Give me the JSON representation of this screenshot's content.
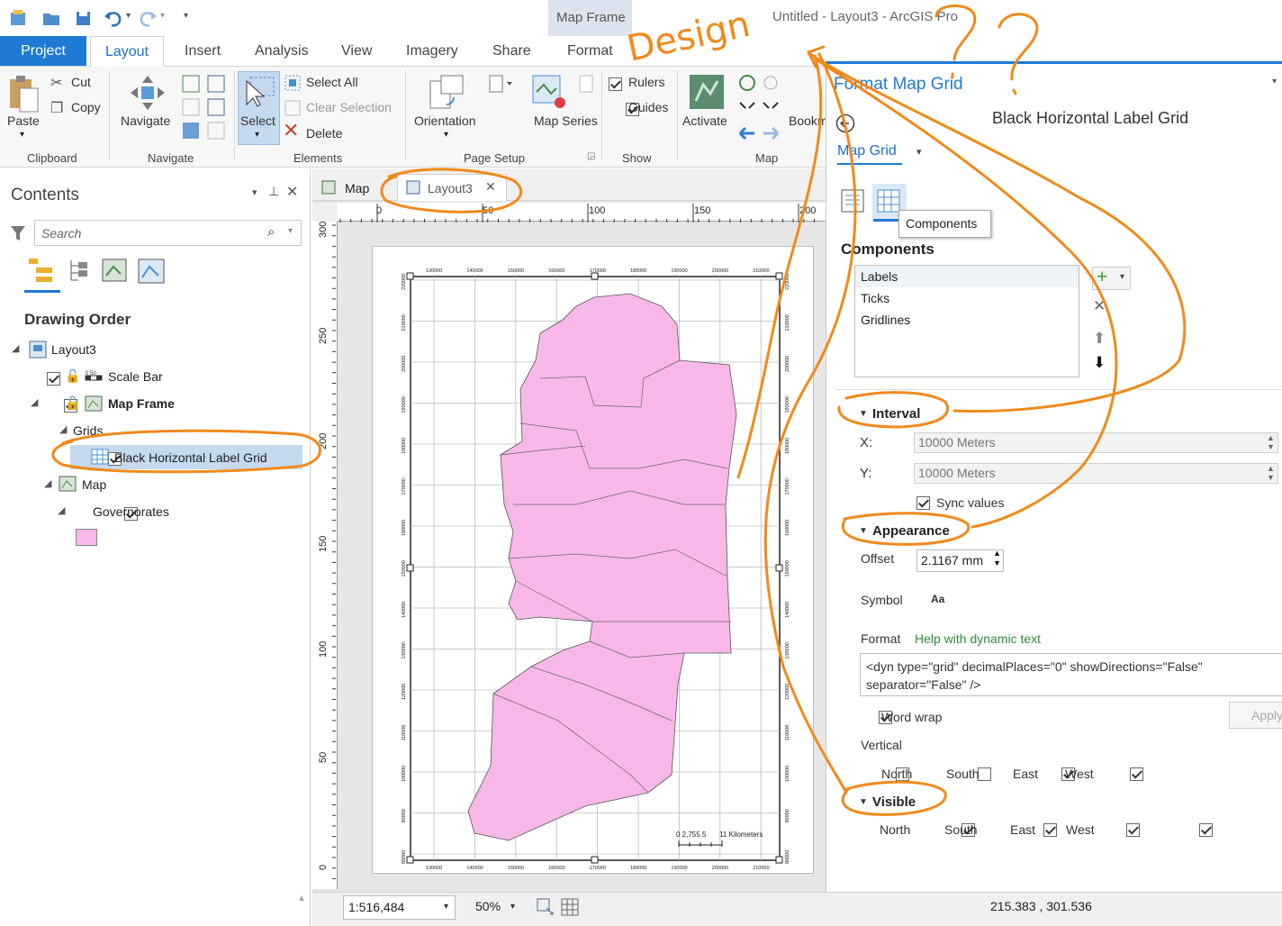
{
  "window_title": "Untitled - Layout3 - ArcGIS Pro",
  "context_tab_group": "Map Frame",
  "tabs": [
    "Project",
    "Layout",
    "Insert",
    "Analysis",
    "View",
    "Imagery",
    "Share",
    "Format"
  ],
  "ribbon": {
    "clipboard": {
      "paste": "Paste",
      "cut": "Cut",
      "copy": "Copy",
      "label": "Clipboard"
    },
    "navigate": {
      "navigate": "Navigate",
      "label": "Navigate"
    },
    "elements": {
      "select": "Select",
      "select_all": "Select All",
      "clear_selection": "Clear Selection",
      "delete": "Delete",
      "label": "Elements"
    },
    "page_setup": {
      "orientation": "Orientation",
      "map_series": "Map Series",
      "label": "Page Setup"
    },
    "show": {
      "rulers": "Rulers",
      "guides": "Guides",
      "label": "Show"
    },
    "map": {
      "activate": "Activate",
      "bookmarks": "Bookm",
      "label": "Map"
    }
  },
  "contents": {
    "title": "Contents",
    "search_placeholder": "Search",
    "drawing_order": "Drawing Order",
    "tree": {
      "layout": "Layout3",
      "scale_bar": "Scale Bar",
      "map_frame": "Map Frame",
      "grids": "Grids",
      "grid_item": "Black Horizontal Label Grid",
      "map": "Map",
      "governorates": "Governorates"
    }
  },
  "view_tabs": {
    "map": "Map",
    "layout": "Layout3"
  },
  "rulers": {
    "top": [
      "0",
      "50",
      "100",
      "150",
      "200"
    ],
    "left": [
      "300",
      "250",
      "200",
      "150",
      "100",
      "50",
      "0"
    ]
  },
  "grid_labels": {
    "x": [
      "130000",
      "140000",
      "150000",
      "160000",
      "170000",
      "180000",
      "190000",
      "200000",
      "210000"
    ],
    "y": [
      "220000",
      "210000",
      "200000",
      "190000",
      "180000",
      "170000",
      "160000",
      "150000",
      "140000",
      "130000",
      "120000",
      "110000",
      "100000",
      "90000",
      "80000"
    ]
  },
  "scalebar_text": {
    "left": "0 2,755.5",
    "right": "11 Kilometers"
  },
  "format_panel": {
    "title": "Format Map Grid",
    "element_name": "Black Horizontal Label Grid",
    "map_grid": "Map Grid",
    "tooltip": "Components",
    "components_header": "Components",
    "components": [
      "Labels",
      "Ticks",
      "Gridlines"
    ],
    "interval_header": "Interval",
    "x_label": "X:",
    "x_value": "10000 Meters",
    "y_label": "Y:",
    "y_value": "10000 Meters",
    "sync_values": "Sync values",
    "appearance_header": "Appearance",
    "offset_label": "Offset",
    "offset_value": "2.1167 mm",
    "symbol_label": "Symbol",
    "symbol_value": "Aa",
    "format_label": "Format",
    "help_link": "Help with dynamic text",
    "format_text": "<dyn type=\"grid\" decimalPlaces=\"0\" showDirections=\"False\" separator=\"False\" />",
    "word_wrap": "Word wrap",
    "apply": "Apply",
    "vertical_header": "Vertical",
    "vertical": [
      {
        "label": "North",
        "checked": false
      },
      {
        "label": "South",
        "checked": false
      },
      {
        "label": "East",
        "checked": true
      },
      {
        "label": "West",
        "checked": true
      }
    ],
    "visible_header": "Visible",
    "visible": [
      {
        "label": "North",
        "checked": true
      },
      {
        "label": "South",
        "checked": true
      },
      {
        "label": "East",
        "checked": true
      },
      {
        "label": "West",
        "checked": true
      }
    ]
  },
  "status": {
    "scale": "1:516,484",
    "zoom": "50%",
    "coords": "215.383 , 301.536"
  },
  "annotations": {
    "design": "Design",
    "questions": "? ?"
  },
  "colors": {
    "accent": "#1f7ad6",
    "polygon": "#f7b8e8",
    "annotation": "#f08a1c"
  }
}
